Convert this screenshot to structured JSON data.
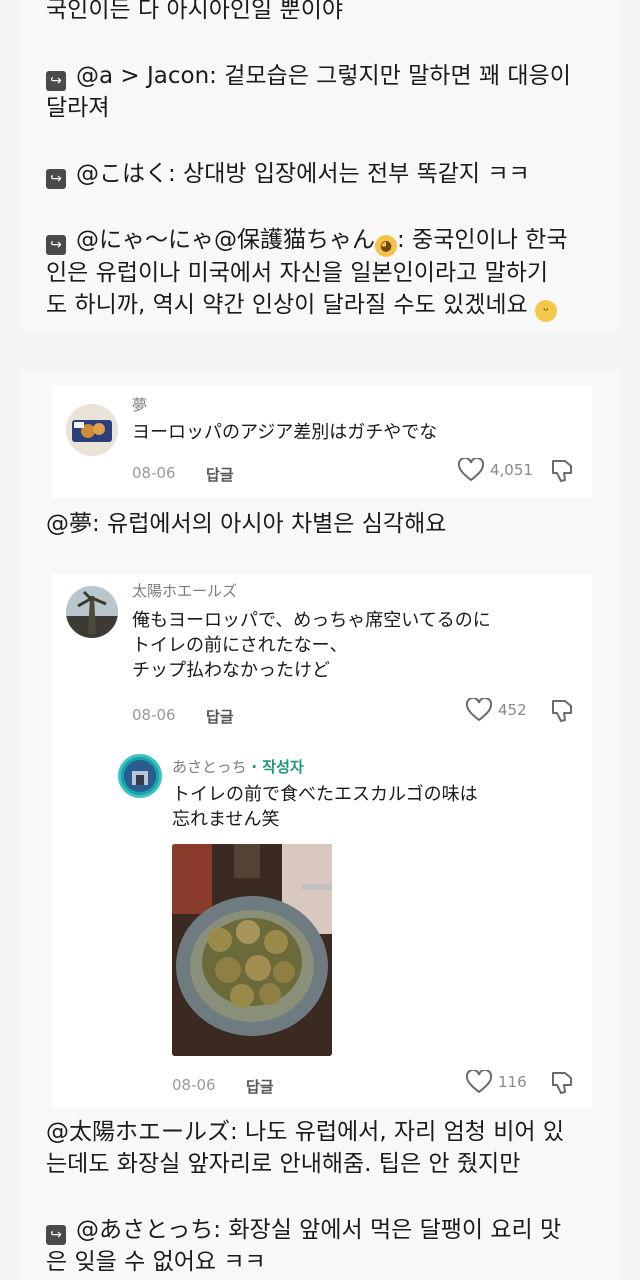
{
  "top_post": {
    "line1": "국인이든 다 아시아인일 뿐이야",
    "reply1": {
      "prefix": "@a > Jacon: 겉모습은 그렇지만 말하면 꽤 대응이",
      "line2": "달라져"
    },
    "reply2": {
      "prefix": "@こはく: 상대방 입장에서는 전부 똑같지 ㅋㅋ"
    },
    "reply3": {
      "prefix": "@にゃ〜にゃ@保護猫ちゃん",
      "suffix": ": 중국인이나 한국",
      "line2": "인은 유럽이나 미국에서 자신을 일본인이라고 말하기",
      "line3": "도 하니까, 역시 약간 인상이 달라질 수도 있겠네요"
    }
  },
  "comment1": {
    "username": "夢",
    "text": "ヨーロッパのアジア差別はガチやでな",
    "date": "08-06",
    "reply_label": "답글",
    "likes": "4,051"
  },
  "translation1": "@夢: 유럽에서의 아시아 차별은 심각해요",
  "comment2": {
    "username": "太陽ホエールズ",
    "lines": [
      "俺もヨーロッパで、めっちゃ席空いてるのに",
      "トイレの前にされたなー、",
      "チップ払わなかったけど"
    ],
    "date": "08-06",
    "reply_label": "답글",
    "likes": "452"
  },
  "comment3": {
    "username": "あさとっち",
    "author_tag": "· 작성자",
    "lines": [
      "トイレの前で食べたエスカルゴの味は",
      "忘れません笑"
    ],
    "date": "08-06",
    "reply_label": "답글",
    "likes": "116"
  },
  "translation2": {
    "line1": "@太陽ホエールズ: 나도 유럽에서, 자리 엄청 비어 있",
    "line2": "는데도 화장실 앞자리로 안내해줌. 팁은 안 줬지만"
  },
  "translation3": {
    "line1": "@あさとっち: 화장실 앞에서 먹은 달팽이 요리 맛",
    "line2": "은 잊을 수 없어요 ㅋㅋ"
  },
  "icons": {
    "reply_arrow": "reply-arrow-icon",
    "heart": "heart-icon",
    "dislike": "thumbs-down-icon"
  },
  "colors": {
    "author_tag": "#1b9a75",
    "background": "#f4f4f4"
  }
}
